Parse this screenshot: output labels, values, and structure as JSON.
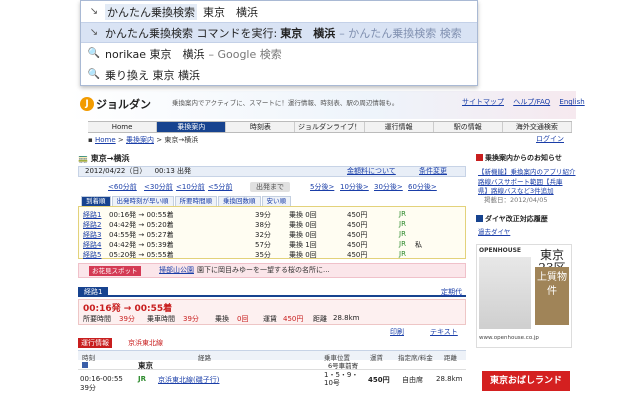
{
  "omnibox": {
    "row1": {
      "keyword": "かんたん乗換検索",
      "query": "東京　横浜"
    },
    "row2": {
      "prefix": "かんたん乗換検索 コマンドを実行:",
      "query": "東京　横浜",
      "suffix": "– かんたん乗換検索 検索"
    },
    "row3": {
      "query": "norikae 東京　横浜",
      "suffix": "– Google 検索"
    },
    "row4": {
      "text": "乗り換え 東京 横浜"
    }
  },
  "header": {
    "logo_mark": "J",
    "logo_text": "ジョルダン",
    "tagline": "乗換案内でアクティブに、スマートに！運行情報、時刻表、駅の周辺情報も。",
    "links": [
      "サイトマップ",
      "ヘルプ/FAQ",
      "English"
    ]
  },
  "nav": {
    "items": [
      "Home",
      "乗換案内",
      "時刻表",
      "ジョルダンライブ！",
      "運行情報",
      "駅の情報",
      "海外交通検索"
    ],
    "active_index": 1
  },
  "breadcrumb": {
    "home": "Home",
    "sep": ">",
    "section": "乗換案内",
    "current": "東京→横浜"
  },
  "login": "ログイン",
  "search": {
    "title": "東京→横浜",
    "date": "2012/04/22（日）",
    "time": "00:13 出発",
    "link1": "金額料について",
    "link2": "条件変更"
  },
  "steps": {
    "earlier": [
      "<60分前",
      "<30分前",
      "<10分前",
      "<5分前"
    ],
    "middle": "出発まで",
    "later": [
      "5分後>",
      "10分後>",
      "30分後>",
      "60分後>"
    ]
  },
  "sort_tabs": [
    "到着順",
    "出発時刻が早い順",
    "所要時間順",
    "乗換回数順",
    "安い順"
  ],
  "routes": [
    {
      "label": "経路1",
      "time": "00:16発 → 00:55着",
      "duration": "39分",
      "transfers": "乗換 0回",
      "fare": "450円",
      "line": "JR",
      "extra": ""
    },
    {
      "label": "経路2",
      "time": "04:42発 → 05:20着",
      "duration": "38分",
      "transfers": "乗換 0回",
      "fare": "450円",
      "line": "JR",
      "extra": ""
    },
    {
      "label": "経路3",
      "time": "04:55発 → 05:27着",
      "duration": "32分",
      "transfers": "乗換 0回",
      "fare": "450円",
      "line": "JR",
      "extra": ""
    },
    {
      "label": "経路4",
      "time": "04:42発 → 05:39着",
      "duration": "57分",
      "transfers": "乗換 1回",
      "fare": "450円",
      "line": "JR",
      "extra": "私"
    },
    {
      "label": "経路5",
      "time": "05:20発 → 05:55着",
      "duration": "35分",
      "transfers": "乗換 0回",
      "fare": "450円",
      "line": "JR",
      "extra": ""
    }
  ],
  "spot": {
    "badge": "お花見スポット",
    "link": "掃部山公園",
    "text": "園下に岡目みゆーを一望する桜の名所に..."
  },
  "result": {
    "badge": "経路1",
    "print_link": "定期代",
    "time": "00:16発 → 00:55着",
    "duration_label": "所要時間",
    "duration": "39分",
    "ride_label": "乗車時間",
    "ride": "39分",
    "transfer_label": "乗換",
    "transfer": "0回",
    "fare_label": "運賃",
    "fare": "450円",
    "distance_label": "距離",
    "distance": "28.8km",
    "print": "印刷",
    "text": "テキスト"
  },
  "info": {
    "badge": "運行情報",
    "link": "京浜東北線"
  },
  "columns": [
    "時刻",
    "経路",
    "乗車位置",
    "運賃",
    "指定席/料金",
    "距離"
  ],
  "station": {
    "name": "東京",
    "car": "6号車前寄"
  },
  "segment": {
    "time": "00:16-00:55",
    "duration": "39分",
    "line_mark": "JR",
    "line": "京浜東北線(磯子行)",
    "position": "1・5・9・10号",
    "fare": "450円",
    "seat": "自由席",
    "distance": "28.8km"
  },
  "right": {
    "notice_head": "乗換案内からのお知らせ",
    "notice1": "【新機能】乗換案内のアプリ紹介",
    "notice2": "路線バスサポート範囲【兵庫",
    "notice3": "県】路線バスなど3件追加",
    "notice_date": "掲載日：2012/04/05",
    "delay_head": "ダイヤ改正対応履歴",
    "delay_link": "過去ダイヤ",
    "ad_brand": "OPENHOUSE",
    "ad_title": "東京23区",
    "ad_sub": "上質物件",
    "ad_url": "www.openhouse.co.jp",
    "ad2": "東京おばしランド"
  }
}
